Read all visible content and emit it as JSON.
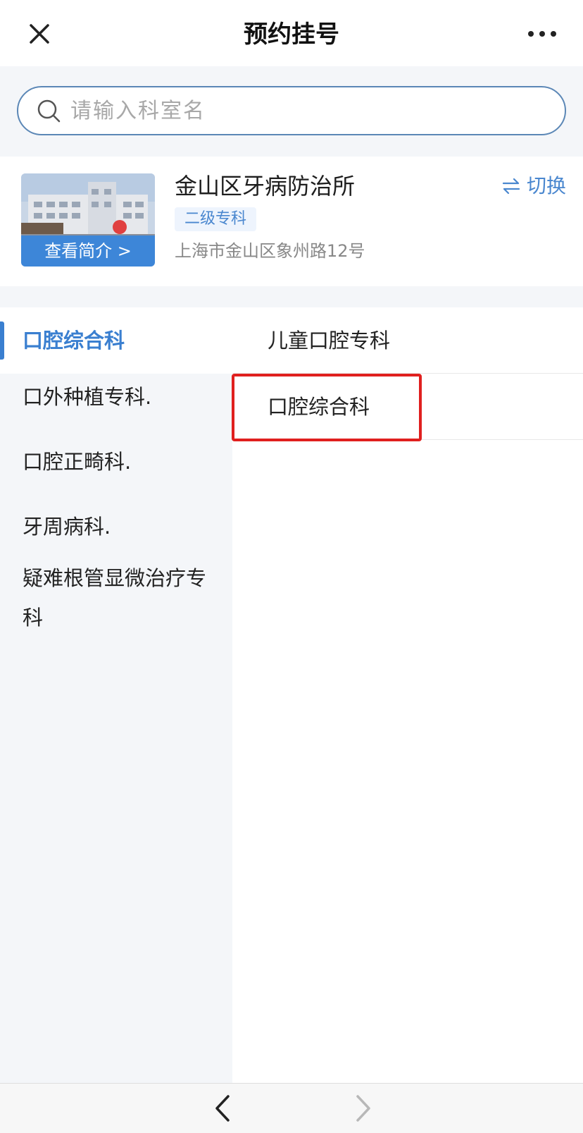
{
  "header": {
    "title": "预约挂号",
    "close_icon": "close-icon",
    "more_icon": "more-dots-icon"
  },
  "search": {
    "placeholder": "请输入科室名",
    "value": ""
  },
  "hospital": {
    "name": "金山区牙病防治所",
    "level": "二级专科",
    "address": "上海市金山区象州路12号",
    "view_intro_label": "查看简介 >",
    "switch_label": "切换"
  },
  "departments": [
    {
      "label": "口腔综合科",
      "active": true
    },
    {
      "label": "口外种植专科.",
      "active": false
    },
    {
      "label": "口腔正畸科.",
      "active": false
    },
    {
      "label": "牙周病科.",
      "active": false
    },
    {
      "label": "疑难根管显微治疗专科",
      "active": false
    }
  ],
  "sub_departments": [
    {
      "label": "儿童口腔专科"
    },
    {
      "label": "口腔综合科"
    }
  ],
  "colors": {
    "accent": "#3a7fd0",
    "highlight": "#e0201f",
    "sidebar_bg": "#f4f6f9"
  }
}
